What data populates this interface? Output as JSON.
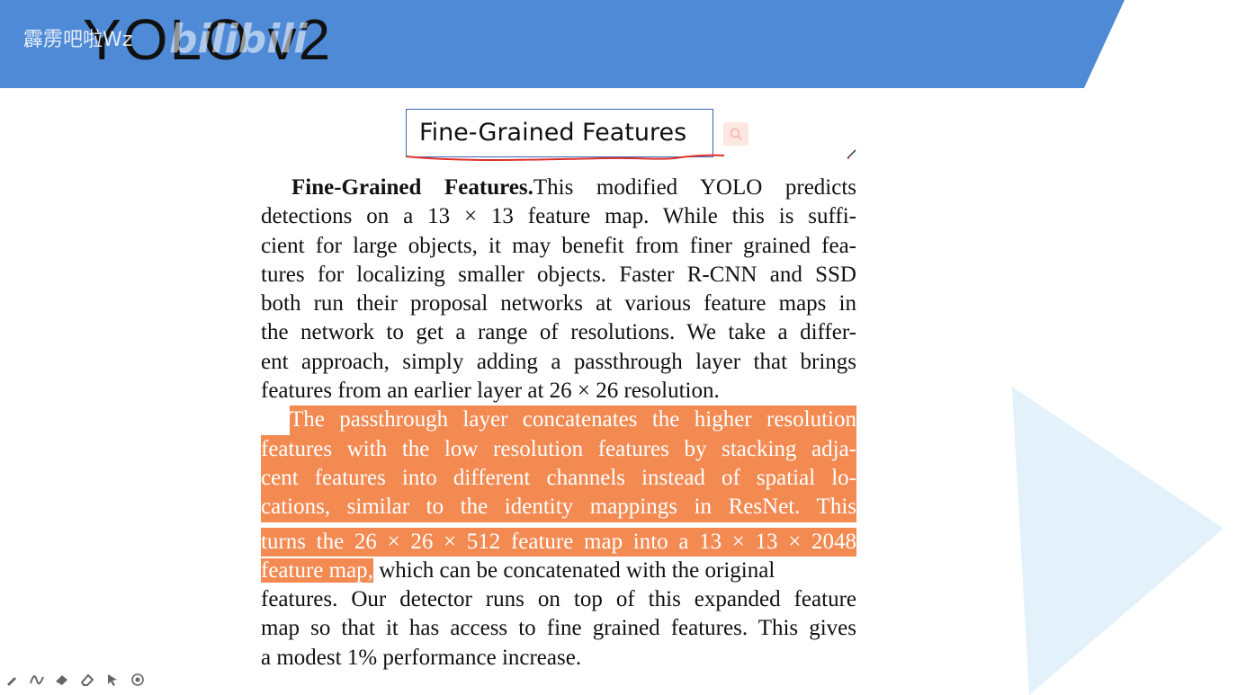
{
  "header": {
    "title": "YOLO v2",
    "watermark_user": "霹雳吧啦Wz",
    "watermark_logo": "bilibili"
  },
  "slide": {
    "heading": "Fine-Grained Features"
  },
  "paper": {
    "para1": {
      "bold_lead": "Fine-Grained Features.",
      "lines": [
        "This modified YOLO predicts",
        "detections on a 13 × 13 feature map.  While this is suffi-",
        "cient for large objects, it may benefit from finer grained fea-",
        "tures for localizing smaller objects. Faster R-CNN and SSD",
        "both run their proposal networks at various feature maps in",
        "the network to get a range of resolutions. We take a differ-",
        "ent approach, simply adding a passthrough layer that brings",
        "features from an earlier layer at 26 × 26 resolution."
      ]
    },
    "para2": {
      "highlighted_lines": [
        "The passthrough layer concatenates the higher resolution",
        "features with the low resolution features by stacking adja-",
        "cent features into different channels instead of spatial lo-",
        "cations, similar to the identity mappings in ResNet.  This",
        "turns the 26 × 26 × 512 feature map into a 13 × 13 × 2048"
      ],
      "highlighted_tail": "feature map,",
      "tail_rest": " which can be concatenated with the original",
      "lines": [
        "features. Our detector runs on top of this expanded feature",
        "map so that it has access to fine grained features. This gives",
        "a modest 1% performance increase."
      ]
    }
  },
  "toolbar": {
    "tools": [
      "pen-icon",
      "ink-icon",
      "highlighter-icon",
      "eraser-icon",
      "pointer-icon",
      "target-icon"
    ]
  },
  "colors": {
    "banner": "#4f8ad6",
    "highlight": "#f28a52",
    "heading_border": "#3c63b5",
    "triangle": "#e3f1fb"
  }
}
